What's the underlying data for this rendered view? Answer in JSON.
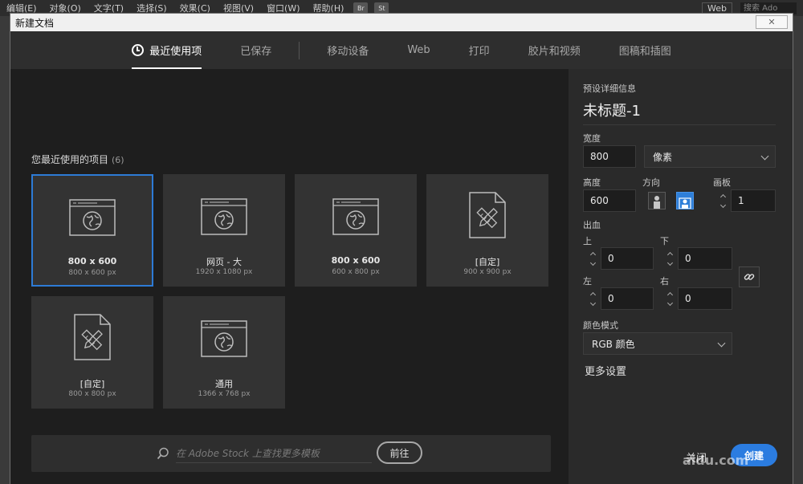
{
  "menubar": {
    "items": [
      "编辑(E)",
      "对象(O)",
      "文字(T)",
      "选择(S)",
      "效果(C)",
      "视图(V)",
      "窗口(W)",
      "帮助(H)"
    ],
    "icons": [
      "Br",
      "St"
    ],
    "workspace": "Web",
    "search_placeholder": "搜索 Ado"
  },
  "dialog": {
    "title": "新建文档",
    "close_label": "✕"
  },
  "tabs": [
    {
      "label": "最近使用项",
      "active": true
    },
    {
      "label": "已保存",
      "active": false
    },
    {
      "label": "移动设备",
      "active": false
    },
    {
      "label": "Web",
      "active": false
    },
    {
      "label": "打印",
      "active": false
    },
    {
      "label": "胶片和视频",
      "active": false
    },
    {
      "label": "图稿和插图",
      "active": false
    }
  ],
  "recent": {
    "title": "您最近使用的项目",
    "count": "(6)",
    "items": [
      {
        "name": "800 x 600",
        "dims": "800 x 600 px",
        "icon": "web-icon",
        "selected": true
      },
      {
        "name": "网页 - 大",
        "dims": "1920 x 1080 px",
        "icon": "web-icon",
        "selected": false
      },
      {
        "name": "800 x 600",
        "dims": "600 x 800 px",
        "icon": "web-icon",
        "selected": false
      },
      {
        "name": "[自定]",
        "dims": "900 x 900 px",
        "icon": "document-icon",
        "selected": false
      },
      {
        "name": "[自定]",
        "dims": "800 x 800 px",
        "icon": "document-icon",
        "selected": false
      },
      {
        "name": "通用",
        "dims": "1366 x 768 px",
        "icon": "web-icon",
        "selected": false
      }
    ]
  },
  "stock": {
    "placeholder": "在 Adobe Stock 上查找更多模板",
    "go_label": "前往"
  },
  "preset": {
    "section_title": "预设详细信息",
    "doc_name": "未标题-1",
    "width_label": "宽度",
    "width_value": "800",
    "unit": "像素",
    "height_label": "高度",
    "height_value": "600",
    "orientation_label": "方向",
    "artboard_label": "画板",
    "artboard_value": "1",
    "bleed_label": "出血",
    "bleed_top_label": "上",
    "bleed_top": "0",
    "bleed_bottom_label": "下",
    "bleed_bottom": "0",
    "bleed_left_label": "左",
    "bleed_left": "0",
    "bleed_right_label": "右",
    "bleed_right": "0",
    "color_mode_label": "颜色模式",
    "color_mode": "RGB 颜色",
    "more_settings": "更多设置",
    "close_label": "关闭",
    "create_label": "创建",
    "watermark": "aidu.com"
  },
  "colors": {
    "accent": "#2b7ce0",
    "dialog_bg": "#1e1e1e",
    "panel_bg": "#2a2a2a",
    "card_bg": "#333333"
  }
}
